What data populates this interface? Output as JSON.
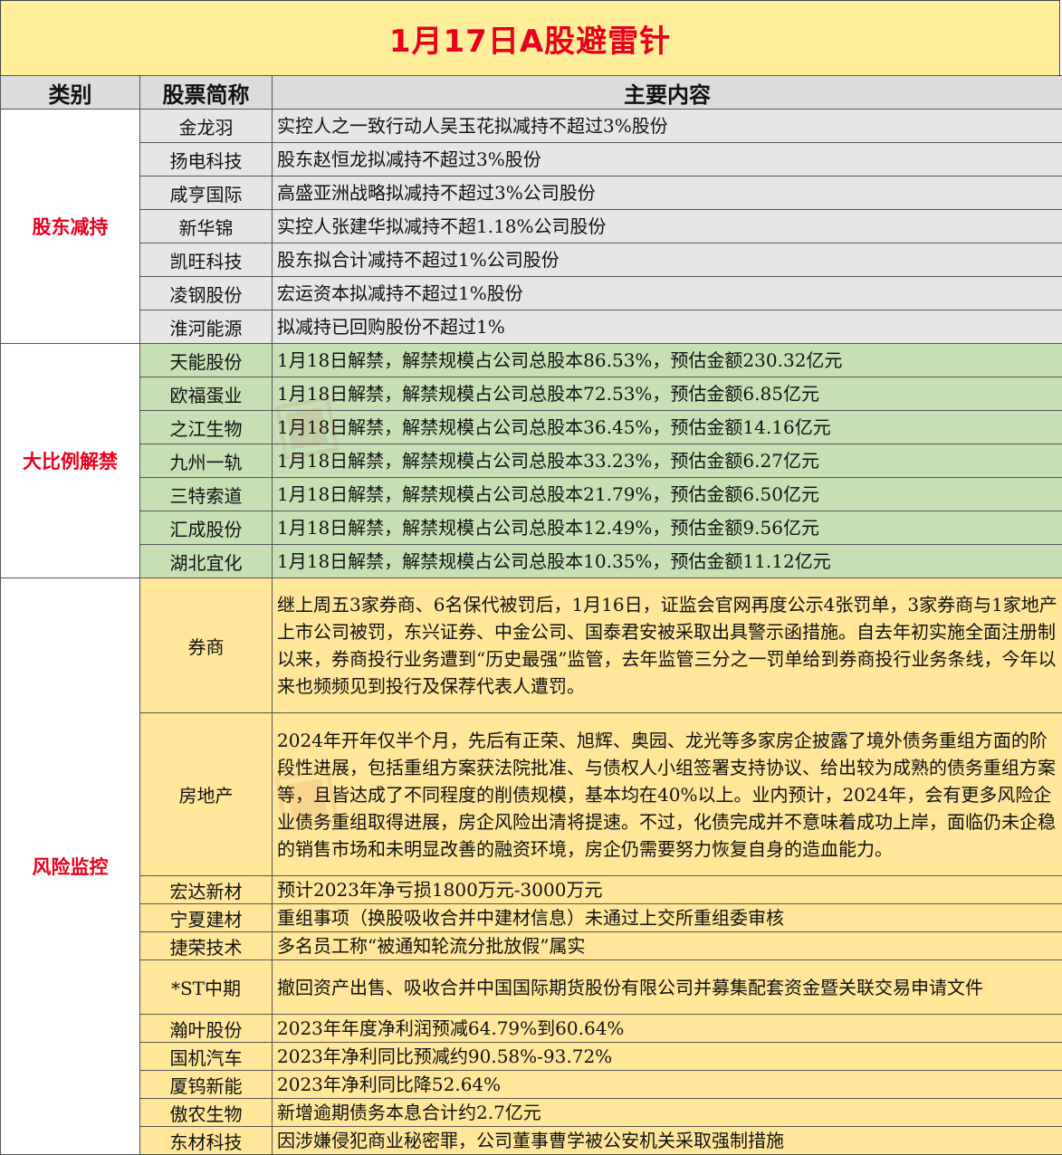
{
  "title": "1月17日A股避雷针",
  "headers": {
    "category": "类别",
    "stock": "股票简称",
    "content": "主要内容"
  },
  "groups": [
    {
      "category": "股东减持",
      "rows": [
        {
          "stock": "金龙羽",
          "content": "实控人之一致行动人吴玉花拟减持不超过3%股份"
        },
        {
          "stock": "扬电科技",
          "content": "股东赵恒龙拟减持不超过3%股份"
        },
        {
          "stock": "咸亨国际",
          "content": "高盛亚洲战略拟减持不超过3%公司股份"
        },
        {
          "stock": "新华锦",
          "content": "实控人张建华拟减持不超1.18%公司股份"
        },
        {
          "stock": "凯旺科技",
          "content": "股东拟合计减持不超过1%公司股份"
        },
        {
          "stock": "凌钢股份",
          "content": "宏运资本拟减持不超过1%股份"
        },
        {
          "stock": "淮河能源",
          "content": "拟减持已回购股份不超过1%"
        }
      ]
    },
    {
      "category": "大比例解禁",
      "rows": [
        {
          "stock": "天能股份",
          "content": "1月18日解禁，解禁规模占公司总股本86.53%，预估金额230.32亿元"
        },
        {
          "stock": "欧福蛋业",
          "content": "1月18日解禁，解禁规模占公司总股本72.53%，预估金额6.85亿元"
        },
        {
          "stock": "之江生物",
          "content": "1月18日解禁，解禁规模占公司总股本36.45%，预估金额14.16亿元"
        },
        {
          "stock": "九州一轨",
          "content": "1月18日解禁，解禁规模占公司总股本33.23%，预估金额6.27亿元"
        },
        {
          "stock": "三特索道",
          "content": "1月18日解禁，解禁规模占公司总股本21.79%，预估金额6.50亿元"
        },
        {
          "stock": "汇成股份",
          "content": "1月18日解禁，解禁规模占公司总股本12.49%，预估金额9.56亿元"
        },
        {
          "stock": "湖北宜化",
          "content": "1月18日解禁，解禁规模占公司总股本10.35%，预估金额11.12亿元"
        }
      ]
    },
    {
      "category": "风险监控",
      "rows": [
        {
          "stock": "券商",
          "content": "继上周五3家券商、6名保代被罚后，1月16日，证监会官网再度公示4张罚单，3家券商与1家地产上市公司被罚，东兴证券、中金公司、国泰君安被采取出具警示函措施。自去年初实施全面注册制以来，券商投行业务遭到“历史最强”监管，去年监管三分之一罚单给到券商投行业务条线，今年以来也频频见到投行及保荐代表人遭罚。"
        },
        {
          "stock": "房地产",
          "content": "2024年开年仅半个月，先后有正荣、旭辉、奥园、龙光等多家房企披露了境外债务重组方面的阶段性进展，包括重组方案获法院批准、与债权人小组签署支持协议、给出较为成熟的债务重组方案等，且皆达成了不同程度的削债规模，基本均在40%以上。业内预计，2024年，会有更多风险企业债务重组取得进展，房企风险出清将提速。不过，化债完成并不意味着成功上岸，面临仍未企稳的销售市场和未明显改善的融资环境，房企仍需要努力恢复自身的造血能力。"
        },
        {
          "stock": "宏达新材",
          "content": "预计2023年净亏损1800万元-3000万元"
        },
        {
          "stock": "宁夏建材",
          "content": "重组事项（换股吸收合并中建材信息）未通过上交所重组委审核"
        },
        {
          "stock": "捷荣技术",
          "content": "多名员工称“被通知轮流分批放假”属实"
        },
        {
          "stock": "*ST中期",
          "content": "撤回资产出售、吸收合并中国国际期货股份有限公司并募集配套资金暨关联交易申请文件"
        },
        {
          "stock": "瀚叶股份",
          "content": "2023年年度净利润预减64.79%到60.64%"
        },
        {
          "stock": "国机汽车",
          "content": "2023年净利同比预减约90.58%-93.72%"
        },
        {
          "stock": "厦钨新能",
          "content": "2023年净利同比降52.64%"
        },
        {
          "stock": "傲农生物",
          "content": "新增逾期债务本息合计约2.7亿元"
        },
        {
          "stock": "东材科技",
          "content": "因涉嫌侵犯商业秘密罪，公司董事曹学被公安机关采取强制措施"
        }
      ]
    }
  ]
}
